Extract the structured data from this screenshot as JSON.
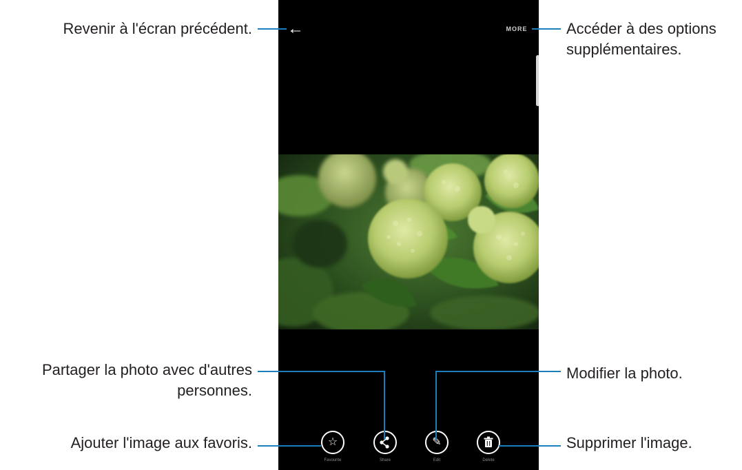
{
  "callouts": {
    "back": "Revenir à l'écran précédent.",
    "more_line1": "Accéder à des options",
    "more_line2": "supplémentaires.",
    "share_line1": "Partager la photo avec d'autres",
    "share_line2": "personnes.",
    "edit": "Modifier la photo.",
    "favorite": "Ajouter l'image aux favoris.",
    "delete": "Supprimer l'image."
  },
  "screen": {
    "back_icon": "←",
    "more_label": "MORE"
  },
  "bottom_actions": [
    {
      "icon": "☆",
      "icon_name": "star-icon",
      "label": "Favourite"
    },
    {
      "icon": "<",
      "icon_name": "share-icon",
      "label": "Share"
    },
    {
      "icon": "✎",
      "icon_name": "pencil-icon",
      "label": "Edit"
    },
    {
      "icon": "🗑",
      "icon_name": "trash-icon",
      "label": "Delete"
    }
  ],
  "colors": {
    "leader_line": "#1b7fbd",
    "screen_background": "#000000",
    "text": "#231f20"
  }
}
